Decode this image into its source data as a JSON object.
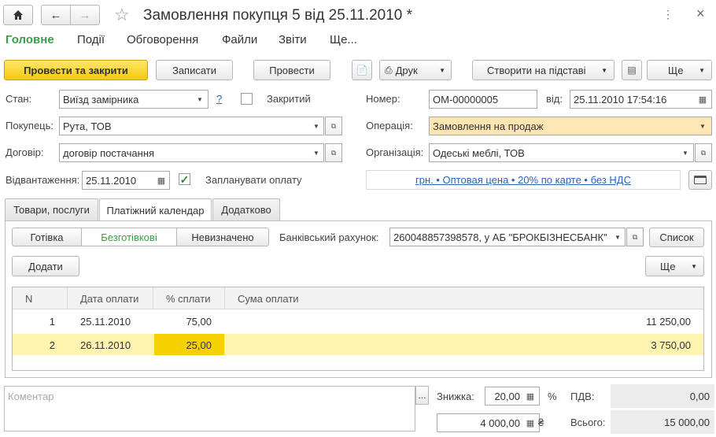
{
  "window": {
    "title": "Замовлення покупця 5 від 25.11.2010 *"
  },
  "menu": {
    "items": [
      "Головне",
      "Події",
      "Обговорення",
      "Файли",
      "Звіти",
      "Ще..."
    ]
  },
  "toolbar": {
    "post_close": "Провести та закрити",
    "save": "Записати",
    "post": "Провести",
    "print": "Друк",
    "create_based": "Створити на підставі",
    "more": "Ще"
  },
  "form": {
    "state_label": "Стан:",
    "state_value": "Виїзд замірника",
    "help": "?",
    "closed_label": "Закритий",
    "buyer_label": "Покупець:",
    "buyer_value": "Рута, ТОВ",
    "contract_label": "Договір:",
    "contract_value": "договір постачання",
    "shipment_label": "Відвантаження:",
    "shipment_value": "25.11.2010",
    "plan_payment_label": "Запланувати оплату",
    "number_label": "Номер:",
    "number_value": "ОМ-00000005",
    "from_label": "від:",
    "from_value": "25.11.2010 17:54:16",
    "operation_label": "Операція:",
    "operation_value": "Замовлення на продаж",
    "org_label": "Організація:",
    "org_value": "Одеські меблі, ТОВ",
    "price_link": "грн. • Оптовая цена • 20% по карте • без НДС"
  },
  "tabs": [
    "Товари, послуги",
    "Платіжний календар",
    "Додатково"
  ],
  "payment": {
    "types": [
      "Готівка",
      "Безготівкові",
      "Невизначено"
    ],
    "bank_label": "Банківський рахунок:",
    "bank_value": "260048857398578, у АБ \"БРОКБІЗНЕСБАНК\"",
    "list_button": "Список",
    "add_button": "Додати",
    "more_button": "Ще"
  },
  "table": {
    "headers": [
      "N",
      "Дата оплати",
      "% сплати",
      "Сума оплати"
    ],
    "rows": [
      {
        "n": "1",
        "date": "25.11.2010",
        "percent": "75,00",
        "sum": "11 250,00"
      },
      {
        "n": "2",
        "date": "26.11.2010",
        "percent": "25,00",
        "sum": "3 750,00"
      }
    ]
  },
  "footer": {
    "comment_placeholder": "Коментар",
    "ellipsis": "...",
    "discount_label": "Знижка:",
    "discount_value": "20,00",
    "percent_sign": "%",
    "amount_value": "4 000,00",
    "currency_sign": "₴",
    "vat_label": "ПДВ:",
    "vat_value": "0,00",
    "total_label": "Всього:",
    "total_value": "15 000,00"
  },
  "colors": {
    "accent_green": "#3a9f4a",
    "primary_yellow": "#f5c90d",
    "highlight_row": "#fff3b0",
    "selected_cell": "#f7d000",
    "operation_bg": "#fde5b4"
  }
}
